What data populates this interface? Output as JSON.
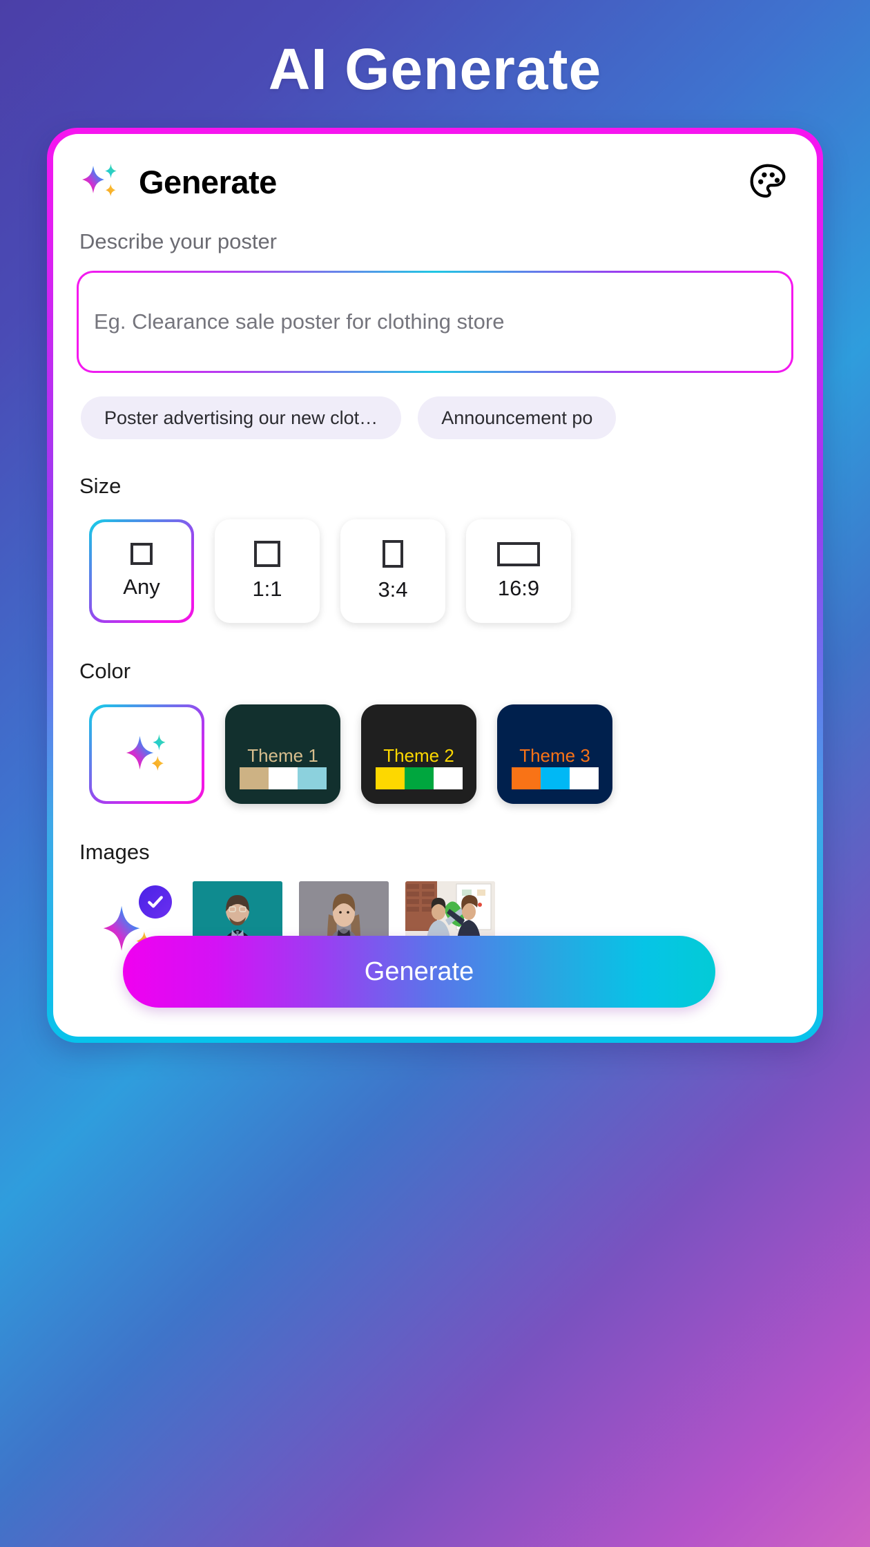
{
  "page": {
    "title": "AI Generate"
  },
  "card": {
    "header": {
      "icon": "sparkles-icon",
      "title": "Generate",
      "palette_icon": "palette-icon"
    },
    "prompt": {
      "label": "Describe your poster",
      "placeholder": "Eg. Clearance sale poster for clothing store",
      "value": ""
    },
    "suggestions": [
      {
        "label": "Poster advertising our new clot…"
      },
      {
        "label": "Announcement po"
      }
    ],
    "size": {
      "label": "Size",
      "options": [
        {
          "label": "Any",
          "ratio": "any",
          "selected": true
        },
        {
          "label": "1:1",
          "ratio": "1:1",
          "selected": false
        },
        {
          "label": "3:4",
          "ratio": "3:4",
          "selected": false
        },
        {
          "label": "16:9",
          "ratio": "16:9",
          "selected": false
        }
      ]
    },
    "color": {
      "label": "Color",
      "options": [
        {
          "label": "",
          "icon": "sparkles-icon",
          "selected": true,
          "bg": "#ffffff"
        },
        {
          "label": "Theme 1",
          "selected": false,
          "bg": "#12302e",
          "text_color": "#d7bd8d",
          "swatches": [
            "#cdb284",
            "#ffffff",
            "#8cd1dd"
          ]
        },
        {
          "label": "Theme 2",
          "selected": false,
          "bg": "#1f1f1f",
          "text_color": "#fdd800",
          "swatches": [
            "#fdd800",
            "#00a63e",
            "#ffffff"
          ]
        },
        {
          "label": "Theme 3",
          "selected": false,
          "bg": "#00204d",
          "text_color": "#f97316",
          "swatches": [
            "#f97316",
            "#00b8f5",
            "#ffffff"
          ]
        }
      ]
    },
    "images": {
      "label": "Images",
      "options": [
        {
          "type": "ai",
          "icon": "sparkles-icon",
          "selected": true,
          "badge": "check-icon"
        },
        {
          "type": "photo",
          "subject": "bearded-man-in-suit-teal-background",
          "selected": false
        },
        {
          "type": "photo",
          "subject": "woman-in-grey-suit-grey-background",
          "selected": false
        },
        {
          "type": "photo",
          "subject": "two-colleagues-high-five-at-office-desk",
          "selected": false
        }
      ]
    },
    "generate_button": {
      "label": "Generate"
    }
  },
  "colors": {
    "accent_magenta": "#f000f0",
    "accent_cyan": "#06c4e6",
    "accent_purple": "#9a3ff2",
    "chip_bg": "#f0edf9"
  }
}
